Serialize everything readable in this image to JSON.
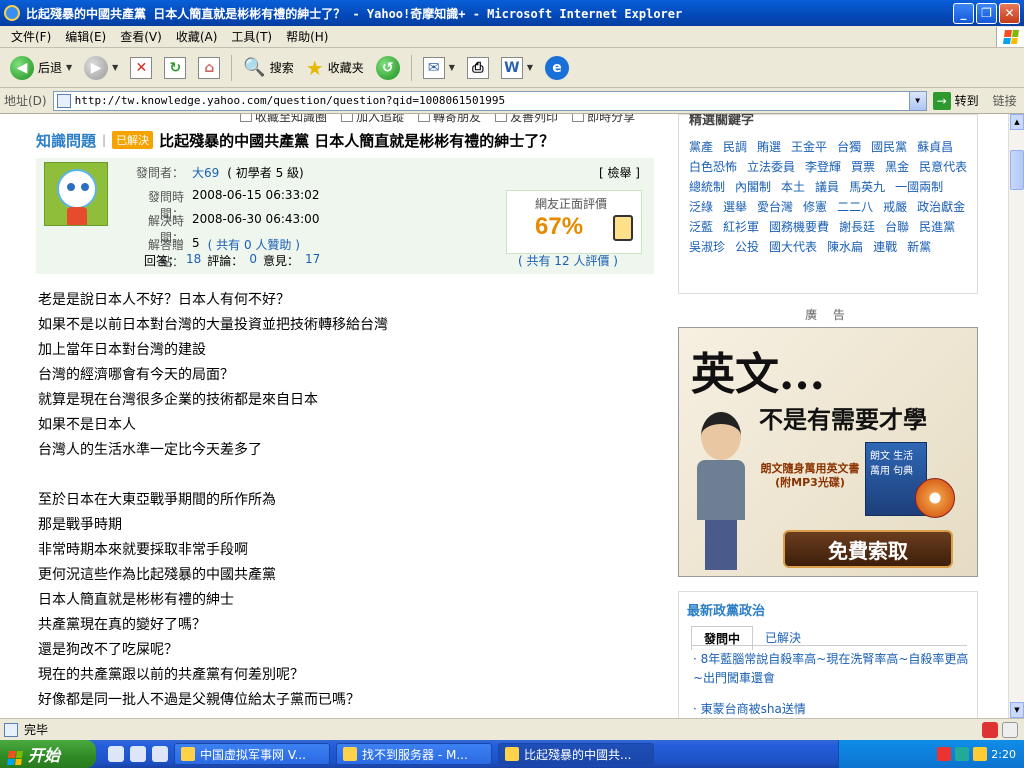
{
  "window": {
    "title": "比起殘暴的中國共產黨 日本人簡直就是彬彬有禮的紳士了？ - Yahoo!奇摩知識+ - Microsoft Internet Explorer",
    "min": "_",
    "max": "❐",
    "close": "✕"
  },
  "menu": [
    "文件(F)",
    "编辑(E)",
    "查看(V)",
    "收藏(A)",
    "工具(T)",
    "帮助(H)"
  ],
  "toolbar": {
    "back": "后退",
    "search": "搜索",
    "favorites": "收藏夹"
  },
  "address": {
    "label": "地址(D)",
    "url": "http://tw.knowledge.yahoo.com/question/question?qid=1008061501995",
    "go": "转到",
    "links": "链接"
  },
  "topstrip": [
    "收藏至知識圈",
    "加入追蹤",
    "轉寄朋友",
    "友善列印",
    "即時分享"
  ],
  "question": {
    "section": "知識問題",
    "status": "已解決",
    "title": "比起殘暴的中國共產黨 日本人簡直就是彬彬有禮的紳士了？",
    "asker_label": "發問者：",
    "asker": "大69",
    "asker_level": "( 初學者 5 級)",
    "report": "[ 檢舉 ]",
    "asked_label": "發問時間：",
    "asked": "2008-06-15 06:33:02",
    "solved_label": "解決時間：",
    "solved": "2008-06-30 06:43:00",
    "points_label": "解答贈點：",
    "points": "5",
    "points_extra": "( 共有 0 人贊助 )",
    "answers_label": "回答：",
    "answers": "18",
    "comments_label": "評論：",
    "comments": "0",
    "opinions_label": "意見：",
    "opinions": "17",
    "rating_label": "網友正面評價",
    "rating": "67%",
    "rating_count": "( 共有 12 人評價 )"
  },
  "answer_lines": [
    "老是是說日本人不好？日本人有何不好？",
    "如果不是以前日本對台灣的大量投資並把技術轉移給台灣",
    "加上當年日本對台灣的建設",
    "台灣的經濟哪會有今天的局面？",
    "就算是現在台灣很多企業的技術都是來自日本",
    "如果不是日本人",
    "台灣人的生活水準一定比今天差多了",
    "",
    "至於日本在大東亞戰爭期間的所作所為",
    "那是戰爭時期",
    "非常時期本來就要採取非常手段啊",
    "更何況這些作為比起殘暴的中國共產黨",
    "日本人簡直就是彬彬有禮的紳士",
    "共產黨現在真的變好了嗎？",
    "還是狗改不了吃屎呢？",
    "現在的共產黨跟以前的共產黨有何差別呢？",
    "好像都是同一批人不過是父親傳位給太子黨而已嗎？"
  ],
  "sidebar": {
    "hot_title": "精選關鍵字",
    "keywords": [
      "黨產",
      "民調",
      "賄選",
      "王金平",
      "台獨",
      "國民黨",
      "蘇貞昌",
      "白色恐怖",
      "立法委員",
      "李登輝",
      "買票",
      "黑金",
      "民意代表",
      "總統制",
      "內閣制",
      "本土",
      "議員",
      "馬英九",
      "一國兩制",
      "泛綠",
      "選舉",
      "愛台灣",
      "修憲",
      "二二八",
      "戒嚴",
      "政治獻金",
      "泛藍",
      "紅衫軍",
      "國務機要費",
      "謝長廷",
      "台聯",
      "民進黨",
      "吳淑珍",
      "公投",
      "國大代表",
      "陳水扁",
      "連戰",
      "新黨"
    ],
    "ad_label": "廣 告",
    "ad": {
      "headline": "英文...",
      "subline": "不是有需要才學",
      "book": "朗文隨身萬用英文書",
      "book_sub": "(附MP3光碟)",
      "book_cover": "朗文 生活萬用 句典",
      "button": "免費索取"
    },
    "news_title": "最新政黨政治",
    "tab_open": "發問中",
    "tab_solved": "已解決",
    "news_items": [
      "8年藍腦常說自殺率高~現在洗腎率高~自殺率更高~出門闖車還會",
      "東蒙台商被sha送情"
    ]
  },
  "status": {
    "text": "完毕"
  },
  "taskbar": {
    "start": "开始",
    "tasks": [
      "中国虚拟军事网 V...",
      "找不到服务器 - M...",
      "比起殘暴的中國共..."
    ],
    "clock": "2:20"
  }
}
